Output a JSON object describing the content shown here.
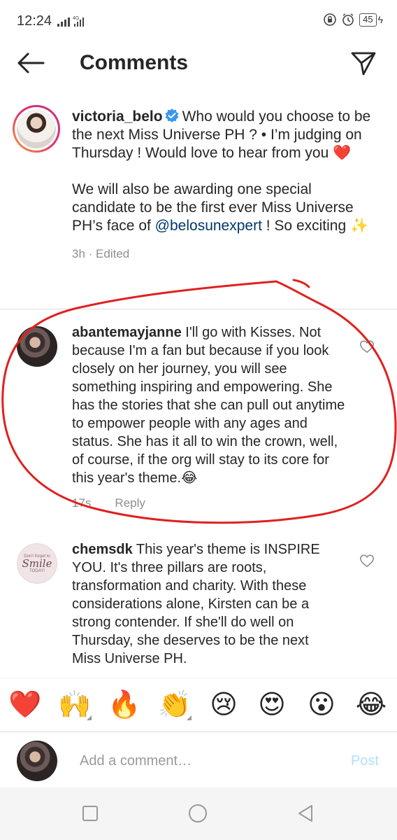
{
  "status_bar": {
    "time": "12:24",
    "network": "4G",
    "battery": "45",
    "icons": [
      "signal-icon",
      "alarm-icon",
      "lock-rotation-icon",
      "battery-icon"
    ]
  },
  "header": {
    "title": "Comments",
    "back_icon": "arrow-left-icon",
    "share_icon": "send-icon"
  },
  "caption": {
    "username": "victoria_belo",
    "verified": true,
    "text_line1": "Who would you choose to be the next Miss Universe PH ? • I’m judging on Thursday ! Would love to hear from you ❤️",
    "text_line2_before": "We will also be awarding one special candidate to be the first ever Miss Universe PH’s face of ",
    "mention": "@belosunexpert",
    "text_line2_after": " ! So exciting ✨",
    "time": "3h",
    "edited": "Edited"
  },
  "comments": [
    {
      "username": "abantemayjanne",
      "text": "I'll go with Kisses. Not because I'm a fan but because if you look closely on her journey, you will see something inspiring and empowering. She has the stories that she can pull out anytime to empower people with any ages and status. She has it all to win the crown, well, of course, if the org will stay to its core for this year's theme.😂",
      "time": "17s",
      "reply": "Reply"
    },
    {
      "username": "chemsdk",
      "text": "This year's theme is INSPIRE YOU. It's three pillars are roots, transformation and charity. With these considerations alone, Kirsten can  be a strong contender. If she'll do well on Thursday, she deserves to be the next Miss Universe PH.",
      "avatar_text_small": "Don't forget to",
      "avatar_text_big": "Smile",
      "avatar_text_tiny": "TODAY!"
    }
  ],
  "emoji_bar": {
    "emojis": [
      "❤️",
      "🙌",
      "🔥",
      "👏",
      "😢",
      "😍",
      "😮",
      "😂"
    ]
  },
  "compose": {
    "placeholder": "Add a comment…",
    "post_label": "Post"
  },
  "colors": {
    "annotation_red": "#e02020",
    "link_blue": "#00376b",
    "post_disabled": "#b2dffc",
    "verified_blue": "#3897f0"
  }
}
